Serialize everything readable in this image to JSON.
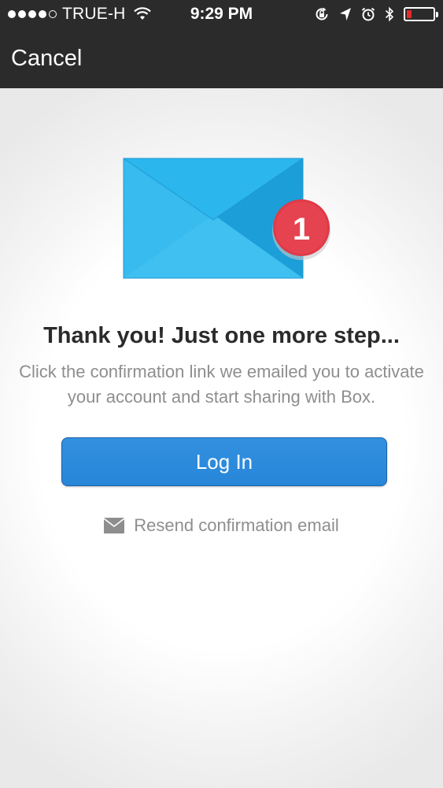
{
  "status_bar": {
    "carrier": "TRUE-H",
    "time": "9:29 PM",
    "signal_bars_filled": 4,
    "signal_bars_total": 5,
    "battery_level": 0.18,
    "icons": [
      "wifi-icon",
      "rotation-lock-icon",
      "location-arrow-icon",
      "alarm-icon",
      "bluetooth-icon",
      "battery-icon"
    ]
  },
  "nav": {
    "cancel_label": "Cancel"
  },
  "illustration": {
    "icon": "envelope-icon",
    "badge_count": "1",
    "envelope_color": "#2bb4ea",
    "badge_color": "#e03a47"
  },
  "message": {
    "headline": "Thank you! Just one more step...",
    "body_line1": "Click the confirmation link we emailed you to activate",
    "body_line2": "your account and start sharing with Box."
  },
  "actions": {
    "login_label": "Log In",
    "resend_label": "Resend confirmation email",
    "login_color": "#2b88da"
  }
}
